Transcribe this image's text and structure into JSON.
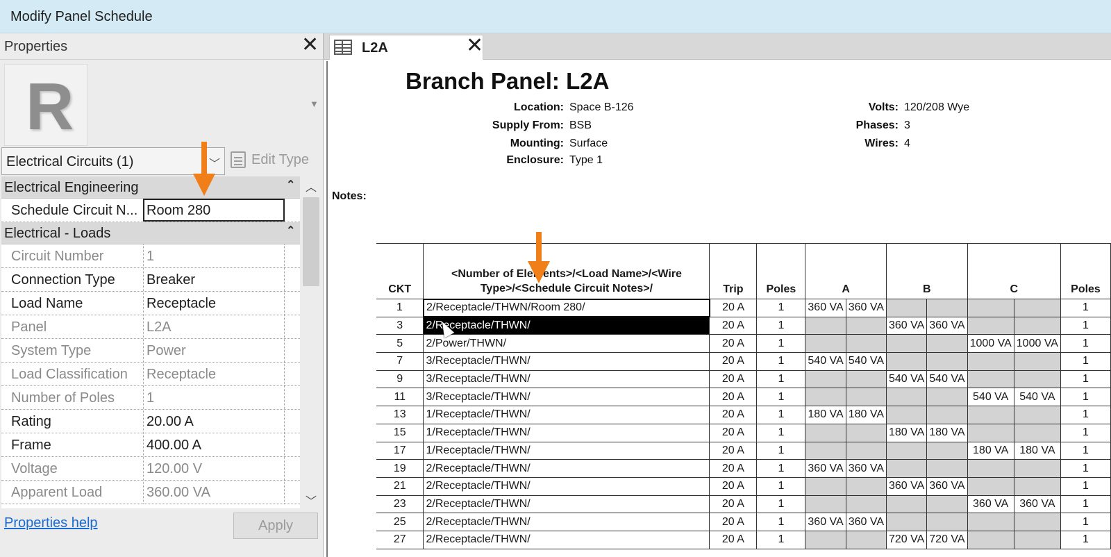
{
  "window": {
    "title": "Modify Panel Schedule"
  },
  "properties": {
    "title": "Properties",
    "type_selector": "Electrical Circuits (1)",
    "edit_type": "Edit Type",
    "groups": [
      {
        "label": "Electrical Engineering"
      },
      {
        "label": "Electrical - Loads"
      }
    ],
    "rows": [
      {
        "name": "Schedule Circuit N...",
        "value": "Room 280"
      },
      {
        "name": "Circuit Number",
        "value": "1"
      },
      {
        "name": "Connection Type",
        "value": "Breaker"
      },
      {
        "name": "Load Name",
        "value": "Receptacle"
      },
      {
        "name": "Panel",
        "value": "L2A"
      },
      {
        "name": "System Type",
        "value": "Power"
      },
      {
        "name": "Load Classification",
        "value": "Receptacle"
      },
      {
        "name": "Number of Poles",
        "value": "1"
      },
      {
        "name": "Rating",
        "value": "20.00 A"
      },
      {
        "name": "Frame",
        "value": "400.00 A"
      },
      {
        "name": "Voltage",
        "value": "120.00 V"
      },
      {
        "name": "Apparent Load",
        "value": "360.00 VA"
      }
    ],
    "help_link": "Properties help",
    "apply": "Apply"
  },
  "tab": {
    "label": "L2A"
  },
  "panel": {
    "title": "Branch Panel: L2A",
    "left_labels": [
      "Location:",
      "Supply From:",
      "Mounting:",
      "Enclosure:"
    ],
    "left_values": [
      "Space B-126",
      "BSB",
      "Surface",
      "Type 1"
    ],
    "right_labels": [
      "Volts:",
      "Phases:",
      "Wires:"
    ],
    "right_values": [
      "120/208 Wye",
      "3",
      "4"
    ],
    "notes_label": "Notes:"
  },
  "schedule": {
    "headers": {
      "ckt": "CKT",
      "desc": "<Number of Elements>/<Load Name>/<Wire Type>/<Schedule Circuit Notes>/",
      "trip": "Trip",
      "poles": "Poles",
      "a": "A",
      "b": "B",
      "c": "C",
      "poles2": "Poles"
    },
    "rows": [
      {
        "ckt": "1",
        "desc": "2/Receptacle/THWN/Room 280/",
        "trip": "20 A",
        "poles": "1",
        "phase": "A",
        "va1": "360 VA",
        "va2": "360 VA",
        "poles2": "1"
      },
      {
        "ckt": "3",
        "desc": "2/Receptacle/THWN/",
        "trip": "20 A",
        "poles": "1",
        "phase": "B",
        "va1": "360 VA",
        "va2": "360 VA",
        "poles2": "1"
      },
      {
        "ckt": "5",
        "desc": "2/Power/THWN/",
        "trip": "20 A",
        "poles": "1",
        "phase": "C",
        "va1": "1000 VA",
        "va2": "1000 VA",
        "poles2": "1"
      },
      {
        "ckt": "7",
        "desc": "3/Receptacle/THWN/",
        "trip": "20 A",
        "poles": "1",
        "phase": "A",
        "va1": "540 VA",
        "va2": "540 VA",
        "poles2": "1"
      },
      {
        "ckt": "9",
        "desc": "3/Receptacle/THWN/",
        "trip": "20 A",
        "poles": "1",
        "phase": "B",
        "va1": "540 VA",
        "va2": "540 VA",
        "poles2": "1"
      },
      {
        "ckt": "11",
        "desc": "3/Receptacle/THWN/",
        "trip": "20 A",
        "poles": "1",
        "phase": "C",
        "va1": "540 VA",
        "va2": "540 VA",
        "poles2": "1"
      },
      {
        "ckt": "13",
        "desc": "1/Receptacle/THWN/",
        "trip": "20 A",
        "poles": "1",
        "phase": "A",
        "va1": "180 VA",
        "va2": "180 VA",
        "poles2": "1"
      },
      {
        "ckt": "15",
        "desc": "1/Receptacle/THWN/",
        "trip": "20 A",
        "poles": "1",
        "phase": "B",
        "va1": "180 VA",
        "va2": "180 VA",
        "poles2": "1"
      },
      {
        "ckt": "17",
        "desc": "1/Receptacle/THWN/",
        "trip": "20 A",
        "poles": "1",
        "phase": "C",
        "va1": "180 VA",
        "va2": "180 VA",
        "poles2": "1"
      },
      {
        "ckt": "19",
        "desc": "2/Receptacle/THWN/",
        "trip": "20 A",
        "poles": "1",
        "phase": "A",
        "va1": "360 VA",
        "va2": "360 VA",
        "poles2": "1"
      },
      {
        "ckt": "21",
        "desc": "2/Receptacle/THWN/",
        "trip": "20 A",
        "poles": "1",
        "phase": "B",
        "va1": "360 VA",
        "va2": "360 VA",
        "poles2": "1"
      },
      {
        "ckt": "23",
        "desc": "2/Receptacle/THWN/",
        "trip": "20 A",
        "poles": "1",
        "phase": "C",
        "va1": "360 VA",
        "va2": "360 VA",
        "poles2": "1"
      },
      {
        "ckt": "25",
        "desc": "2/Receptacle/THWN/",
        "trip": "20 A",
        "poles": "1",
        "phase": "A",
        "va1": "360 VA",
        "va2": "360 VA",
        "poles2": "1"
      },
      {
        "ckt": "27",
        "desc": "2/Receptacle/THWN/",
        "trip": "20 A",
        "poles": "1",
        "phase": "B",
        "va1": "720 VA",
        "va2": "720 VA",
        "poles2": "1"
      }
    ]
  },
  "colors": {
    "accent_arrow": "#f07f1a",
    "title_bar": "#d4ebf5",
    "unused_phase_cell": "#d3d3d3",
    "link": "#1a6bd0"
  }
}
